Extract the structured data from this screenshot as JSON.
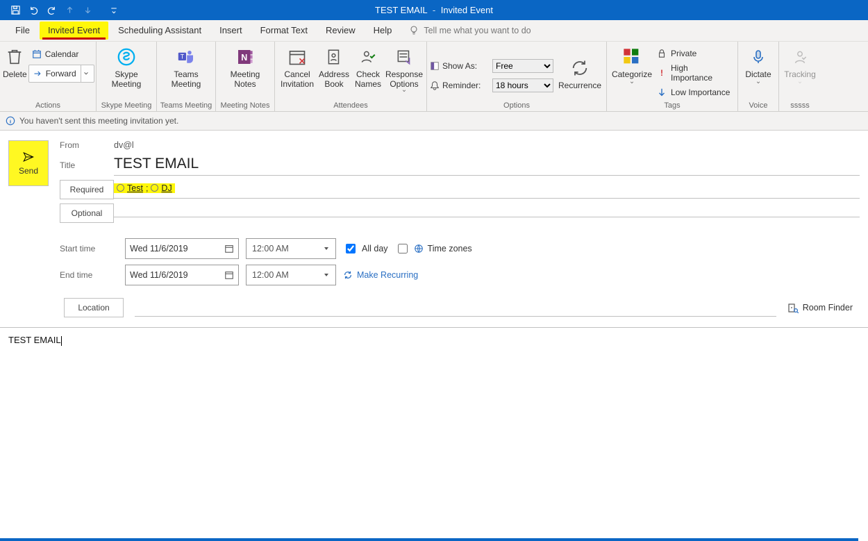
{
  "window": {
    "title_main": "TEST EMAIL",
    "title_sep": "-",
    "title_context": "Invited Event"
  },
  "qat": {
    "save": "Save",
    "undo": "Undo",
    "redo": "Redo",
    "up": "Previous",
    "down": "Next",
    "more": "Customize"
  },
  "tabs": {
    "file": "File",
    "invited_event": "Invited Event",
    "scheduling": "Scheduling Assistant",
    "insert": "Insert",
    "format": "Format Text",
    "review": "Review",
    "help": "Help",
    "tell_me": "Tell me what you want to do"
  },
  "ribbon": {
    "actions": {
      "delete": "Delete",
      "calendar": "Calendar",
      "forward": "Forward",
      "group": "Actions"
    },
    "skype": {
      "btn": "Skype\nMeeting",
      "group": "Skype Meeting"
    },
    "teams": {
      "btn": "Teams\nMeeting",
      "group": "Teams Meeting"
    },
    "onenote": {
      "btn": "Meeting\nNotes",
      "group": "Meeting Notes"
    },
    "attendees": {
      "cancel": "Cancel\nInvitation",
      "address": "Address\nBook",
      "check": "Check\nNames",
      "response": "Response\nOptions",
      "group": "Attendees"
    },
    "options": {
      "show_as": "Show As:",
      "show_as_value": "Free",
      "reminder": "Reminder:",
      "reminder_value": "18 hours",
      "recurrence": "Recurrence",
      "group": "Options"
    },
    "tags": {
      "categorize": "Categorize",
      "private": "Private",
      "high": "High Importance",
      "low": "Low Importance",
      "group": "Tags"
    },
    "voice": {
      "dictate": "Dictate",
      "group": "Voice"
    },
    "sssss": {
      "tracking": "Tracking",
      "group": "sssss"
    }
  },
  "info_bar": "You haven't sent this meeting invitation yet.",
  "form": {
    "send": "Send",
    "from_label": "From",
    "from_value": "dv@l",
    "title_label": "Title",
    "title_value": "TEST EMAIL",
    "required_btn": "Required",
    "optional_btn": "Optional",
    "recipients": [
      "Test",
      "DJ"
    ],
    "recip_sep": ";",
    "start_label": "Start time",
    "end_label": "End time",
    "start_date": "Wed 11/6/2019",
    "end_date": "Wed 11/6/2019",
    "start_time": "12:00 AM",
    "end_time": "12:00 AM",
    "all_day": "All day",
    "time_zones": "Time zones",
    "make_recurring": "Make Recurring",
    "location_btn": "Location",
    "room_finder": "Room Finder"
  },
  "body_text": "TEST EMAIL"
}
